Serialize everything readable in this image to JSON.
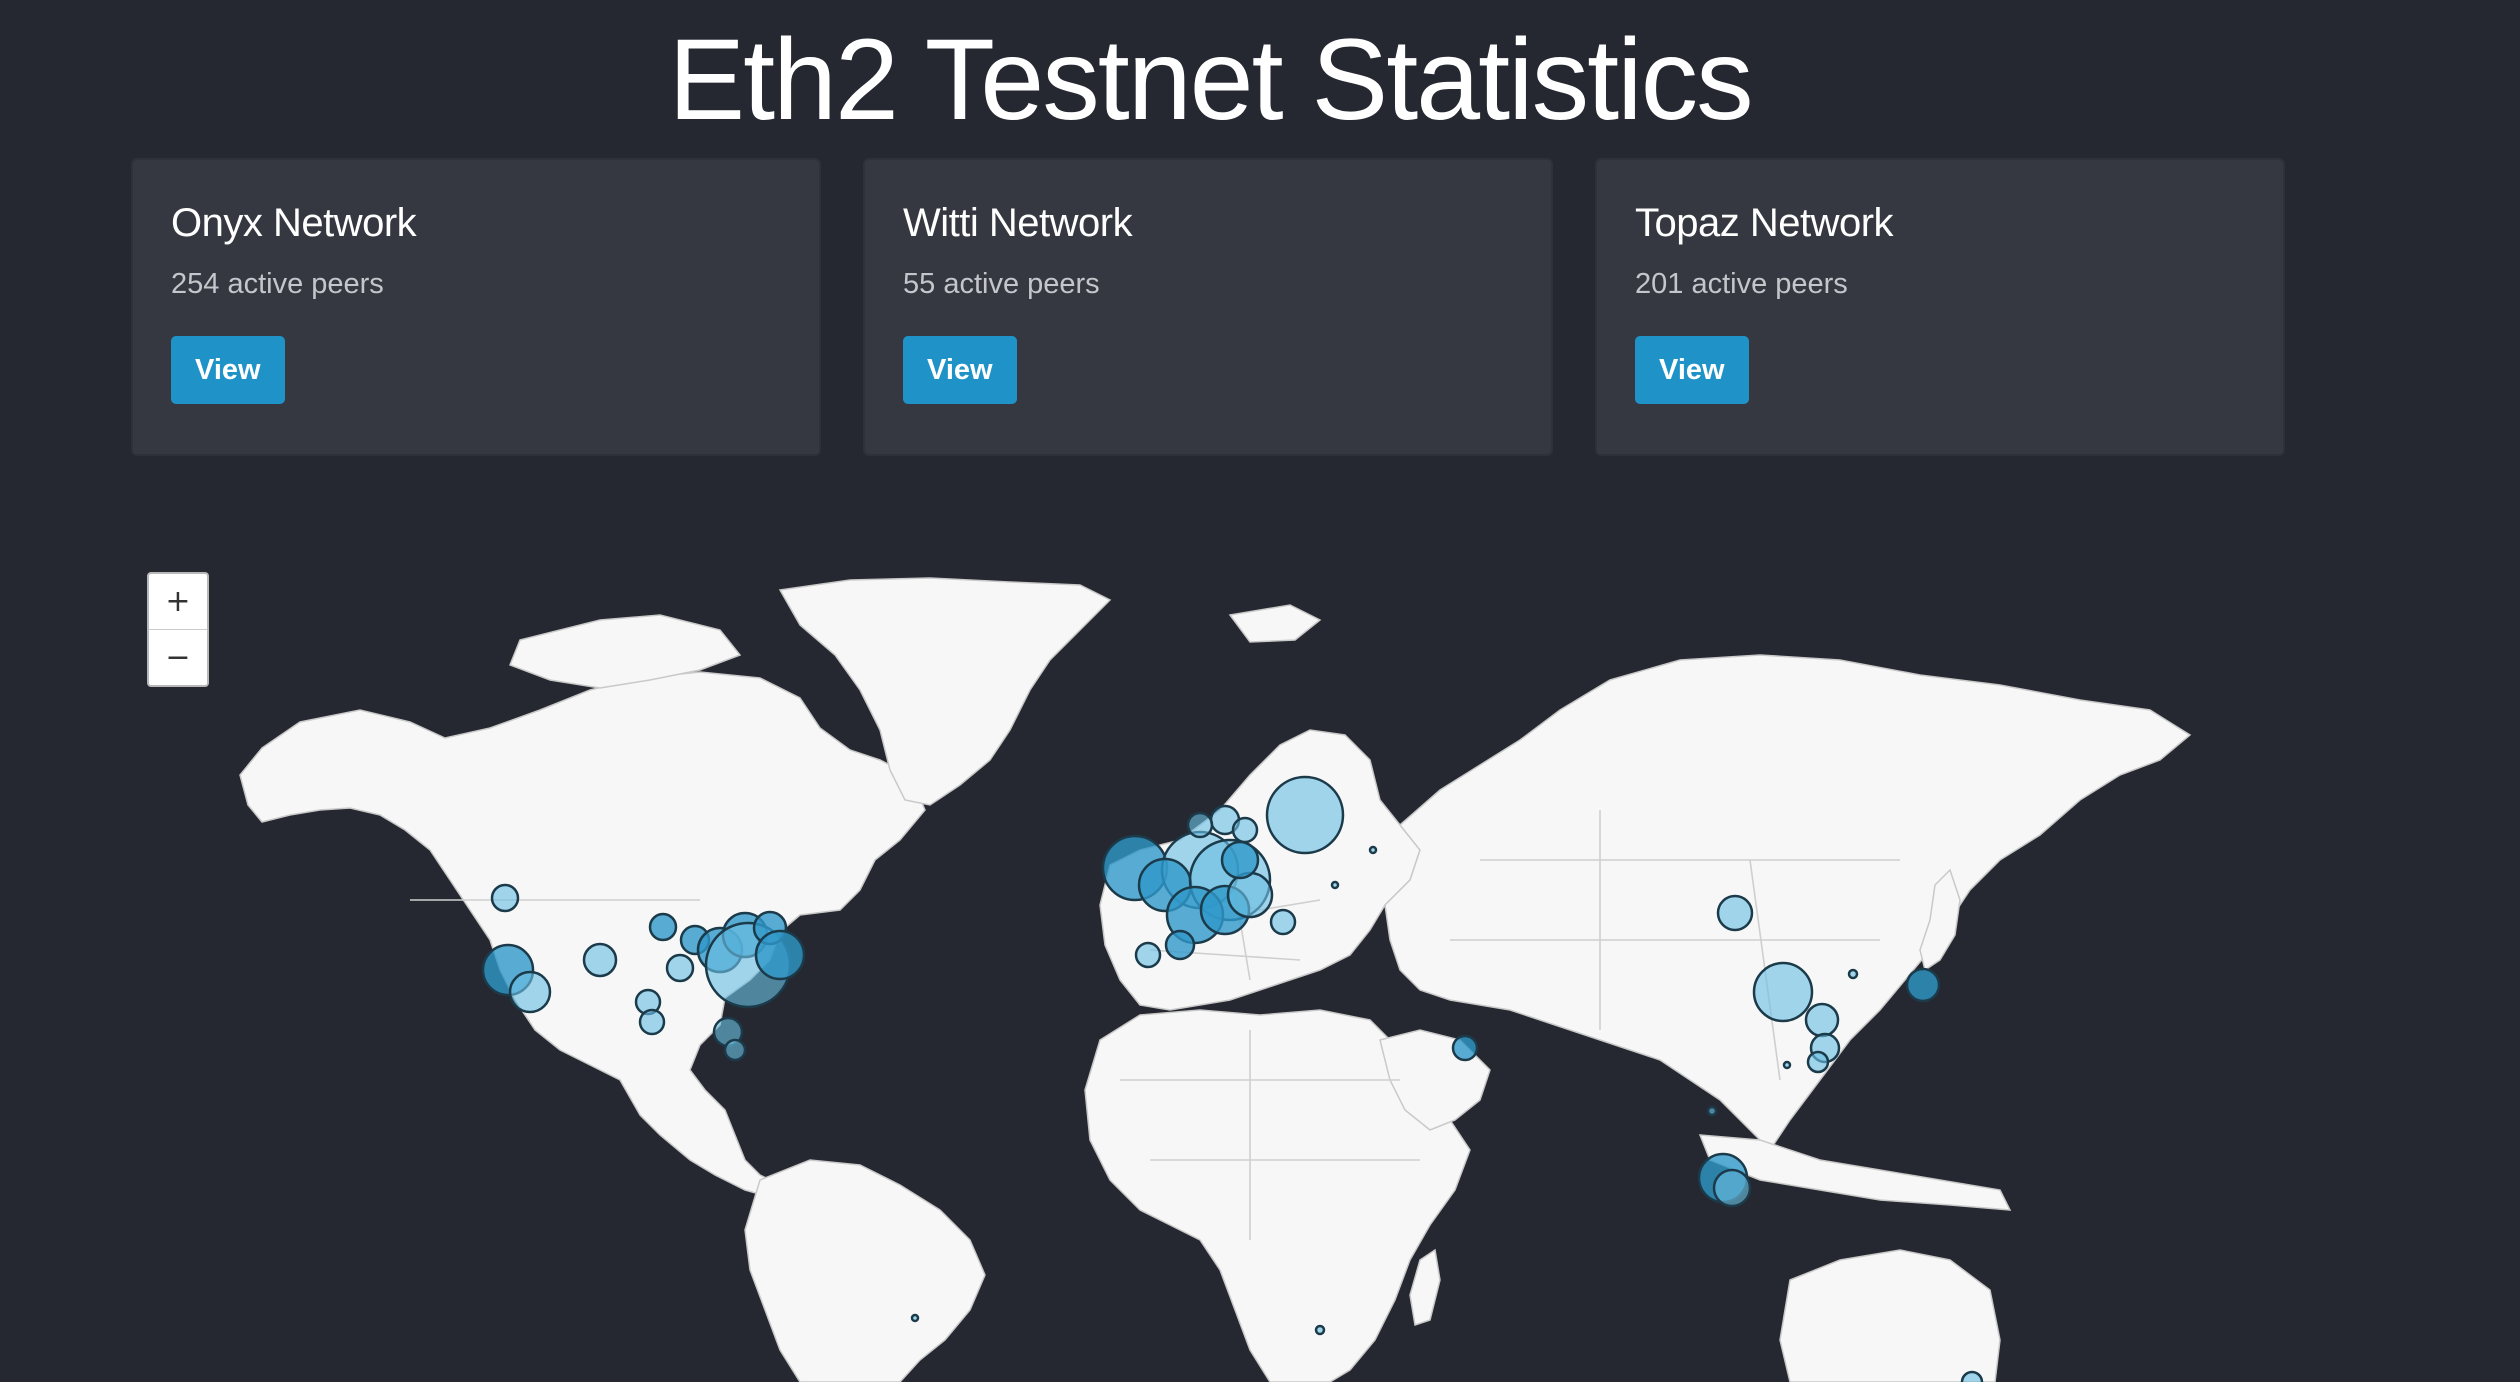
{
  "page": {
    "title": "Eth2 Testnet Statistics"
  },
  "networks": [
    {
      "name": "Onyx Network",
      "peers": "254 active peers",
      "button": "View"
    },
    {
      "name": "Witti Network",
      "peers": "55 active peers",
      "button": "View"
    },
    {
      "name": "Topaz Network",
      "peers": "201 active peers",
      "button": "View"
    }
  ],
  "map": {
    "zoom_in_label": "+",
    "zoom_out_label": "−",
    "land_color": "#f7f7f7",
    "marker_color": "#6bbfe2"
  },
  "colors": {
    "background": "#252830",
    "card": "#353841",
    "button": "#1f93c8"
  }
}
